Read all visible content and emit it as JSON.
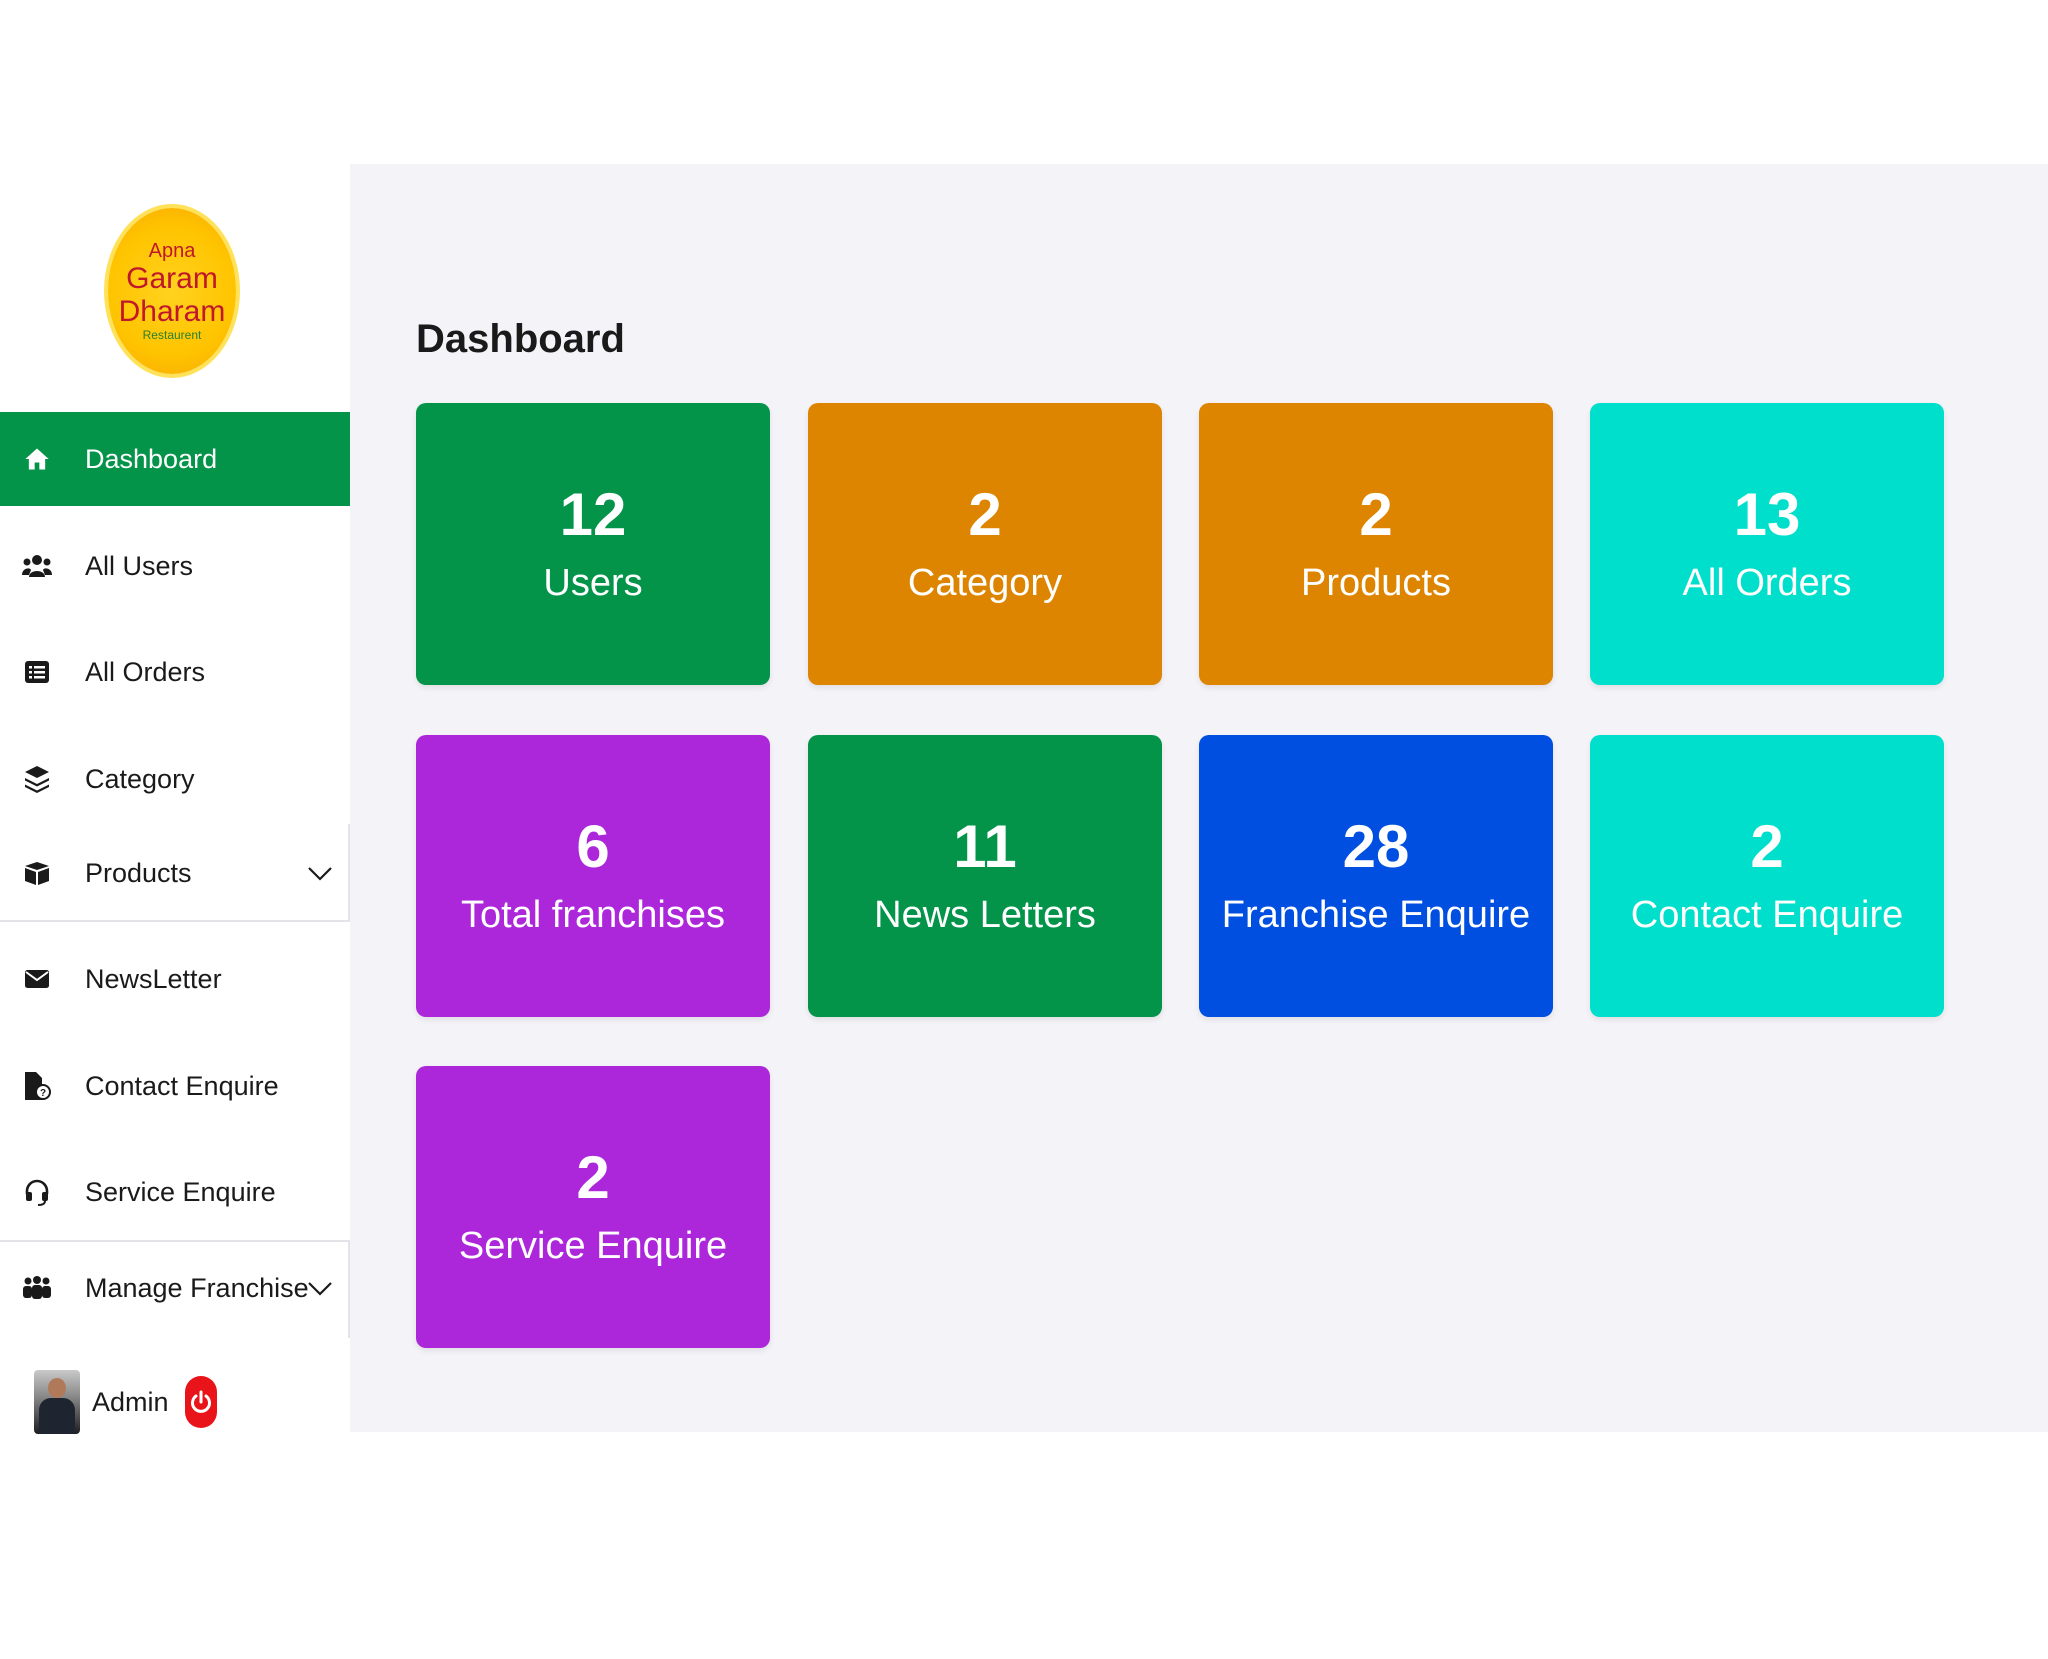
{
  "logo": {
    "line1": "Apna",
    "line2": "Garam",
    "line3": "Dharam",
    "line4": "Restaurent"
  },
  "sidebar": {
    "items": [
      {
        "label": "Dashboard",
        "icon": "home-icon"
      },
      {
        "label": "All Users",
        "icon": "users-icon"
      },
      {
        "label": "All Orders",
        "icon": "list-icon"
      },
      {
        "label": "Category",
        "icon": "layers-icon"
      },
      {
        "label": "Products",
        "icon": "box-icon"
      },
      {
        "label": "NewsLetter",
        "icon": "envelope-icon"
      },
      {
        "label": "Contact Enquire",
        "icon": "file-question-icon"
      },
      {
        "label": "Service Enquire",
        "icon": "headset-icon"
      },
      {
        "label": "Manage Franchise",
        "icon": "group-icon"
      }
    ],
    "user": {
      "name": "Admin"
    }
  },
  "main": {
    "title": "Dashboard",
    "cards": [
      {
        "value": "12",
        "label": "Users",
        "color": "#03944a"
      },
      {
        "value": "2",
        "label": "Category",
        "color": "#dd8500"
      },
      {
        "value": "2",
        "label": "Products",
        "color": "#dd8500"
      },
      {
        "value": "13",
        "label": "All Orders",
        "color": "#00dfcb"
      },
      {
        "value": "6",
        "label": "Total franchises",
        "color": "#ad27da"
      },
      {
        "value": "11",
        "label": "News Letters",
        "color": "#03944a"
      },
      {
        "value": "28",
        "label": "Franchise Enquire",
        "color": "#004fe0"
      },
      {
        "value": "2",
        "label": "Contact Enquire",
        "color": "#00dfcb"
      },
      {
        "value": "2",
        "label": "Service Enquire",
        "color": "#ad27da"
      }
    ]
  },
  "colors": {
    "active": "#03944a",
    "background": "#f3f3f8",
    "power": "#e8141a"
  }
}
